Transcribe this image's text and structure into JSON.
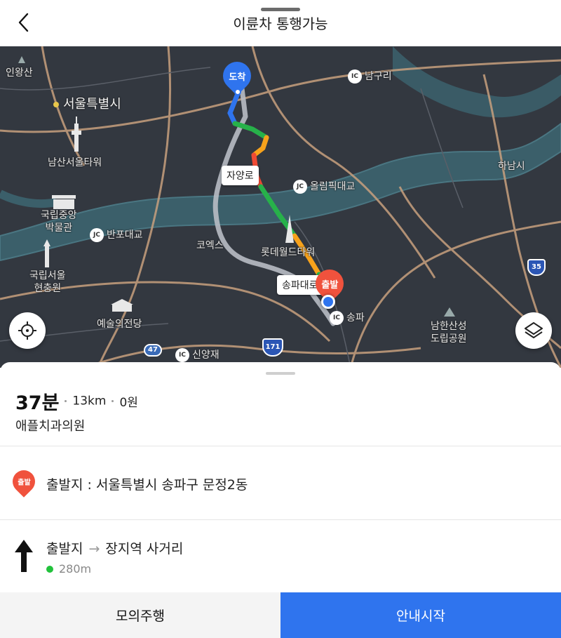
{
  "header": {
    "title": "이륜차 통행가능",
    "back_icon": "chevron-left-icon"
  },
  "map": {
    "labels": {
      "inwangsan": "인왕산",
      "seoul": "서울특별시",
      "namsan_tower": "남산서울타워",
      "museum": "국립중앙\n박물관",
      "cemetery": "국립서울\n현충원",
      "arts": "예술의전당",
      "coex": "코엑스",
      "lotte": "롯데월드타워",
      "hanam": "하남시",
      "namhansan": "남한산성\n도립공원"
    },
    "interchanges": {
      "namguri": "남구리",
      "olympic": "올림픽대교",
      "banpo": "반포대교",
      "songpa": "송파",
      "sinyangjae": "신양재"
    },
    "ic_badges": {
      "ic": "IC",
      "jc": "JC"
    },
    "route_tags": {
      "jayang": "자양로",
      "songpa_daero": "송파대로"
    },
    "pins": {
      "destination": "도착",
      "origin": "출발"
    },
    "shields": {
      "r35": "35",
      "r47": "47",
      "r171": "171"
    },
    "colors": {
      "water": "#3b5f6a",
      "road": "#c8a07e",
      "route_green": "#27b14a",
      "route_orange": "#f7a21b",
      "route_red": "#ef4a34",
      "route_alt": "#b8bcc4",
      "dest_pin": "#2f74ee",
      "origin_pin": "#f0523d"
    }
  },
  "controls": {
    "locate_icon": "crosshair-icon",
    "layers_icon": "layers-icon"
  },
  "summary": {
    "time": "37분",
    "distance": "13km",
    "fare": "0원",
    "destination": "애플치과의원"
  },
  "start": {
    "pin_label": "출발",
    "text": "출발지 : 서울특별시 송파구 문정2동"
  },
  "step": {
    "from": "출발지",
    "to": "장지역 사거리",
    "distance": "280m"
  },
  "buttons": {
    "simulate": "모의주행",
    "start_guidance": "안내시작"
  }
}
